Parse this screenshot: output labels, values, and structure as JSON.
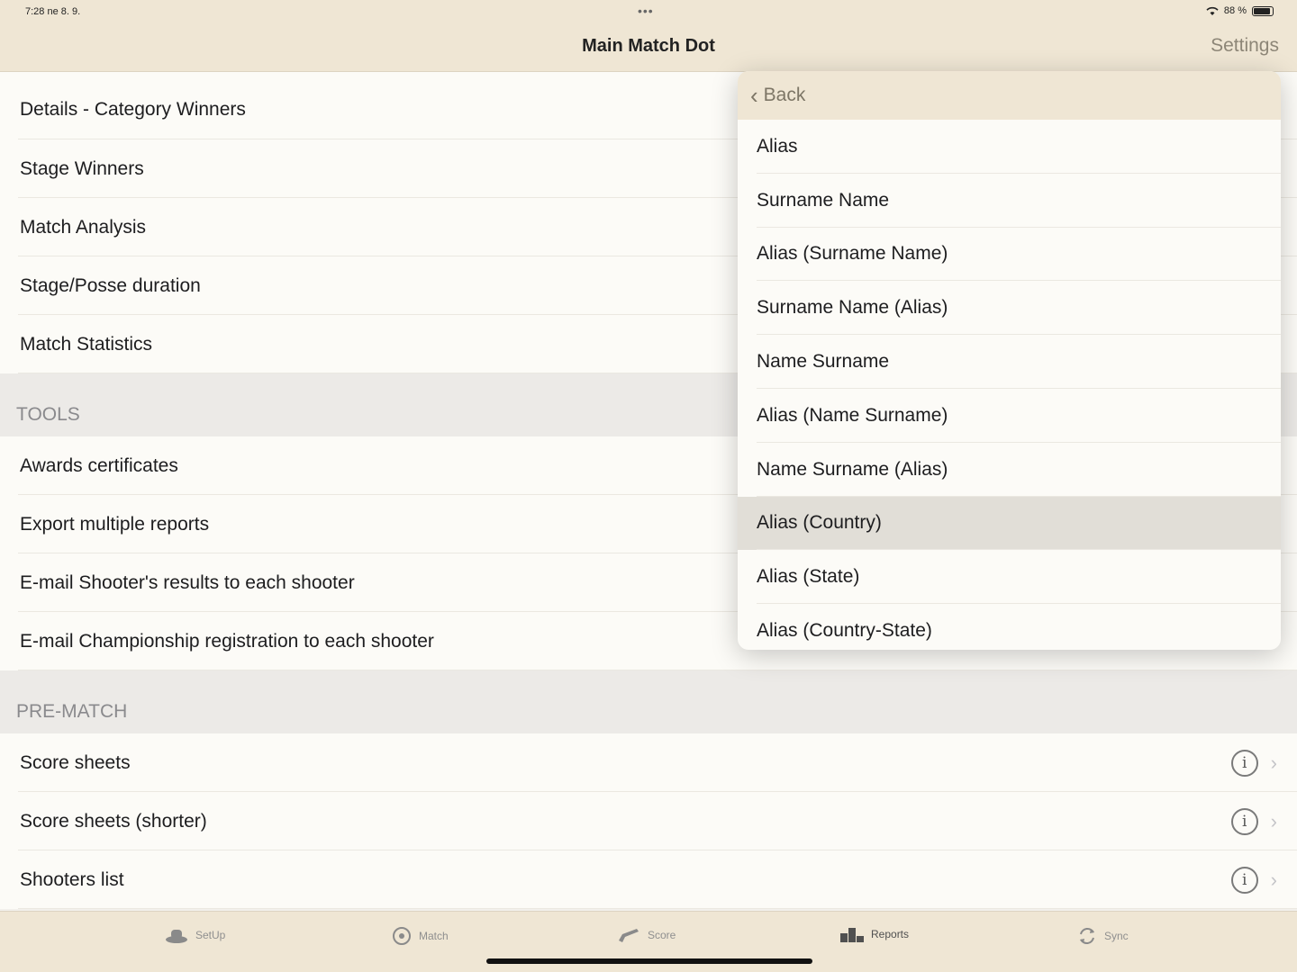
{
  "status_bar": {
    "time": "7:28 ne 8. 9.",
    "battery": "88 %"
  },
  "nav": {
    "title": "Main Match Dot",
    "settings_label": "Settings"
  },
  "list": {
    "top_items": [
      "Details - Category Winners",
      "Stage Winners",
      "Match Analysis",
      "Stage/Posse duration",
      "Match Statistics"
    ],
    "tools_header": "TOOLS",
    "tools_items": [
      "Awards certificates",
      "Export multiple reports",
      "E-mail Shooter's results to each shooter",
      "E-mail Championship registration to each shooter"
    ],
    "prematch_header": "PRE-MATCH",
    "prematch_items": [
      "Score sheets",
      "Score sheets (shorter)",
      "Shooters list"
    ]
  },
  "popover": {
    "back_label": "Back",
    "options": [
      "Alias",
      "Surname Name",
      "Alias (Surname Name)",
      "Surname Name (Alias)",
      "Name Surname",
      "Alias (Name Surname)",
      "Name Surname (Alias)",
      "Alias (Country)",
      "Alias (State)",
      "Alias (Country-State)"
    ],
    "selected": "Alias (Country)"
  },
  "tabs": [
    {
      "label": "SetUp",
      "icon": "hat-icon"
    },
    {
      "label": "Match",
      "icon": "target-icon"
    },
    {
      "label": "Score",
      "icon": "gun-icon"
    },
    {
      "label": "Reports",
      "icon": "podium-icon",
      "active": true
    },
    {
      "label": "Sync",
      "icon": "sync-icon"
    }
  ]
}
